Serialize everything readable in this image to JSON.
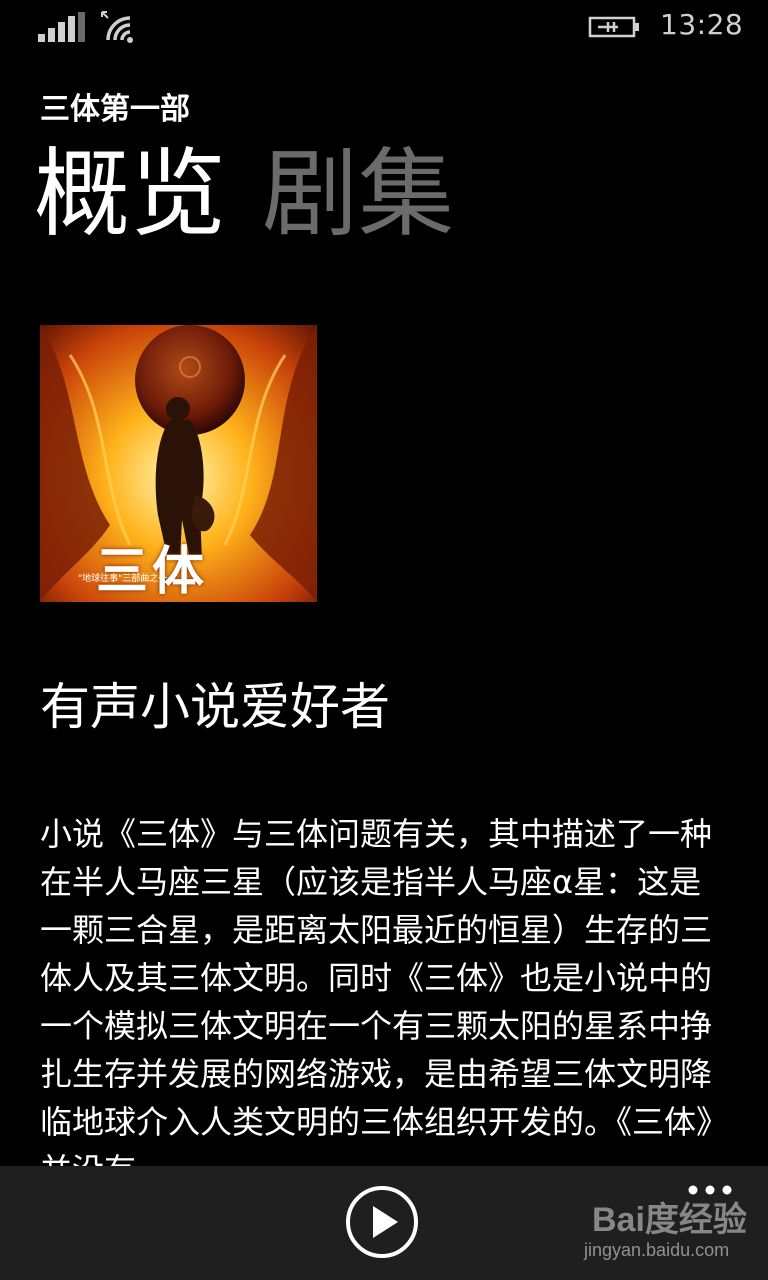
{
  "status_bar": {
    "time": "13:28",
    "signal_icon": "signal-bars-icon",
    "wifi_icon": "wifi-icon",
    "battery_icon": "battery-charging-icon"
  },
  "header": {
    "app_title": "三体第一部",
    "tabs": [
      {
        "label": "概览",
        "active": true
      },
      {
        "label": "剧集",
        "active": false
      }
    ]
  },
  "cover": {
    "title_text": "三体",
    "subtitle_text": "\"地球往事\"三部曲之一"
  },
  "author": "有声小说爱好者",
  "description": "小说《三体》与三体问题有关，其中描述了一种在半人马座三星（应该是指半人马座α星：这是一颗三合星，是距离太阳最近的恒星）生存的三体人及其三体文明。同时《三体》也是小说中的一个模拟三体文明在一个有三颗太阳的星系中挣扎生存并发展的网络游戏，是由希望三体文明降临地球介入人类文明的三体组织开发的。《三体》并没有",
  "app_bar": {
    "play_icon": "play-icon",
    "more_icon": "more-icon"
  },
  "watermark": {
    "logo": "Bai度经验",
    "url": "jingyan.baidu.com"
  },
  "colors": {
    "background": "#000000",
    "app_bar": "#1f1f1f",
    "inactive_tab": "#6b6b6b"
  }
}
